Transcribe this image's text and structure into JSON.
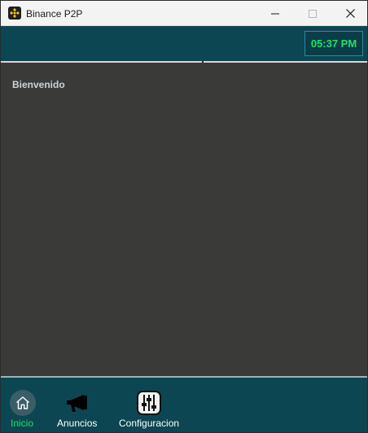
{
  "window": {
    "title": "Binance P2P",
    "icon": "binance-logo-icon",
    "controls": [
      "minimize-icon",
      "maximize-icon",
      "close-icon"
    ]
  },
  "header": {
    "clock": "05:37 PM",
    "clock_color": "#1fe06a",
    "background": "#0c4652"
  },
  "content": {
    "welcome": "Bienvenido",
    "background": "#3a3a38"
  },
  "nav": {
    "items": [
      {
        "label": "Inicio",
        "icon": "home-icon",
        "active": true
      },
      {
        "label": "Anuncios",
        "icon": "megaphone-icon",
        "active": false
      },
      {
        "label": "Configuracion",
        "icon": "sliders-icon",
        "active": false
      }
    ],
    "active_color": "#1fe06a"
  }
}
